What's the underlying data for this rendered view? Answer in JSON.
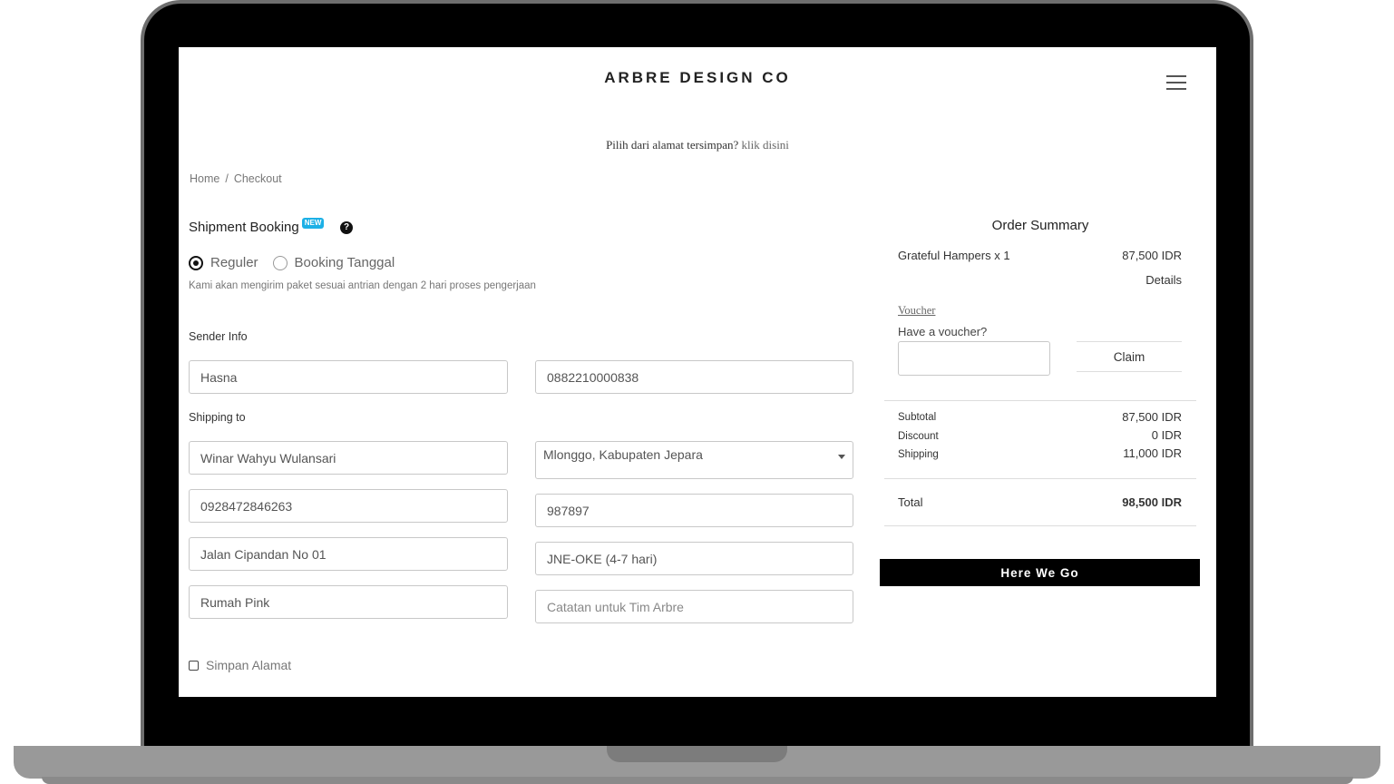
{
  "header": {
    "brand": "ARBRE DESIGN CO"
  },
  "saved_address": {
    "prompt": "Pilih dari alamat tersimpan?",
    "link": "klik disini"
  },
  "breadcrumb": {
    "home": "Home",
    "separator": "/",
    "current": "Checkout"
  },
  "shipment": {
    "title": "Shipment Booking",
    "badge": "NEW",
    "help_glyph": "?",
    "options": [
      {
        "label": "Reguler",
        "selected": true
      },
      {
        "label": "Booking Tanggal",
        "selected": false
      }
    ],
    "description": "Kami akan mengirim paket sesuai antrian dengan 2 hari proses pengerjaan"
  },
  "sender": {
    "label": "Sender Info",
    "name": "Hasna",
    "phone": "0882210000838"
  },
  "shipping": {
    "label": "Shipping to",
    "recipient_name": "Winar Wahyu Wulansari",
    "area": "Mlonggo, Kabupaten Jepara",
    "phone": "0928472846263",
    "postal_code": "987897",
    "address": "Jalan Cipandan No 01",
    "courier": "JNE-OKE (4-7 hari)",
    "address_note": "Rumah Pink",
    "note_placeholder": "Catatan untuk Tim Arbre"
  },
  "save_address": {
    "label": "Simpan Alamat",
    "checked": false
  },
  "order_summary": {
    "title": "Order Summary",
    "item_name": "Grateful Hampers x 1",
    "item_price": "87,500 IDR",
    "details_label": "Details",
    "voucher_link": "Voucher",
    "voucher_prompt": "Have a voucher?",
    "claim_label": "Claim",
    "subtotal_label": "Subtotal",
    "subtotal_value": "87,500 IDR",
    "discount_label": "Discount",
    "discount_value": "0 IDR",
    "shipping_label": "Shipping",
    "shipping_value": "11,000 IDR",
    "total_label": "Total",
    "total_value": "98,500 IDR",
    "submit_label": "Here We Go"
  },
  "colors": {
    "badge": "#1cb0e6",
    "button": "#000000",
    "frame": "#000000"
  }
}
